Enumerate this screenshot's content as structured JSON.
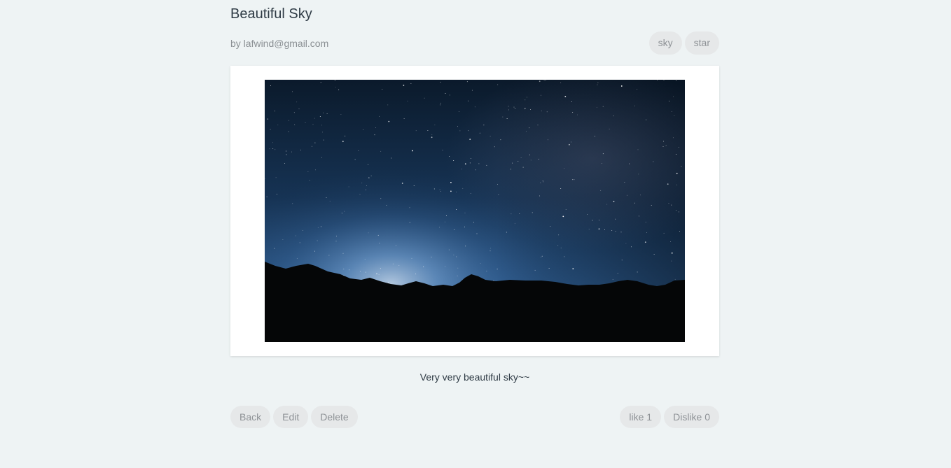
{
  "post": {
    "title": "Beautiful Sky",
    "author": "by lafwind@gmail.com",
    "tags": [
      "sky",
      "star"
    ],
    "description": "Very very beautiful sky~~"
  },
  "actions": {
    "back_label": "Back",
    "edit_label": "Edit",
    "delete_label": "Delete",
    "like_label": "like 1",
    "dislike_label": "Dislike 0"
  },
  "colors": {
    "page_background": "#eef3f4",
    "pill_background": "#e6e8e9",
    "title_text": "#2f3b45",
    "muted_text": "#8a8f93",
    "sky_top": "#0b1a2b",
    "sky_glow": "#4f7db0",
    "mountains": "#050607"
  }
}
